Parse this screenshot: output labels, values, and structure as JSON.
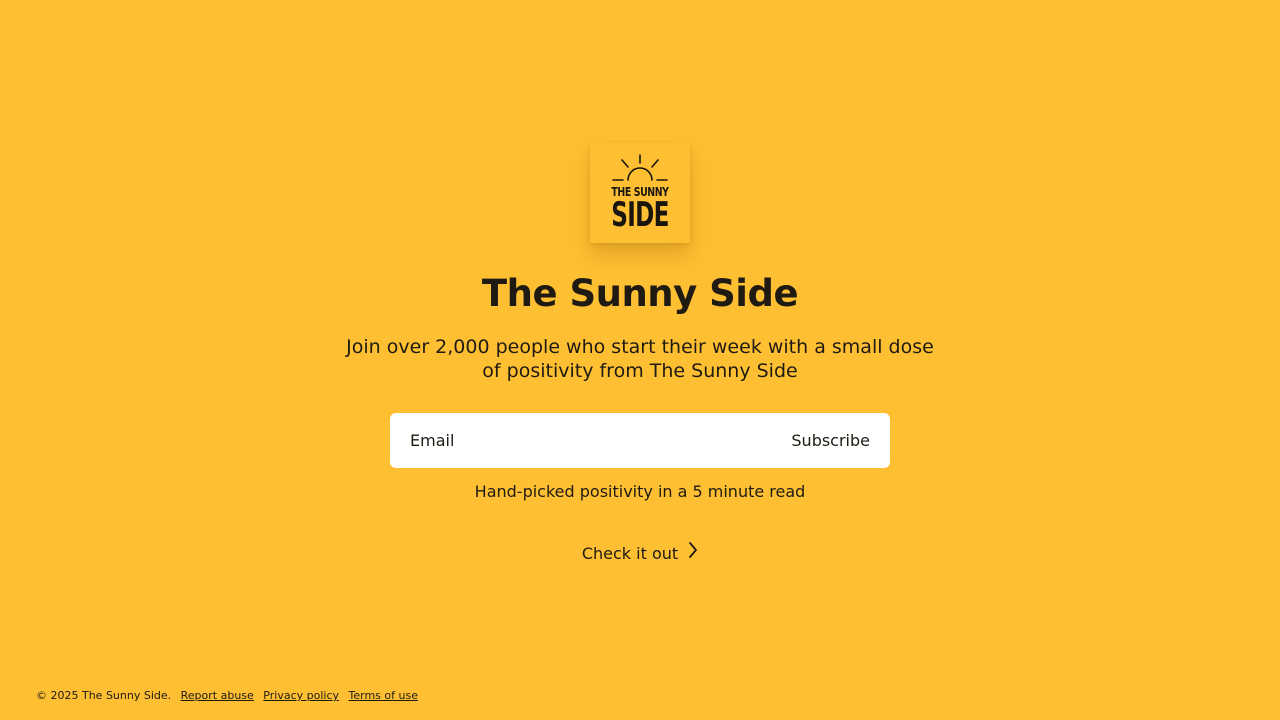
{
  "brand": {
    "logo_line1": "THE SUNNY",
    "logo_line2": "SIDE",
    "logo_icon": "sun-rising-icon"
  },
  "hero": {
    "title": "The Sunny Side",
    "subtitle": "Join over 2,000 people who start their week with a small dose of positivity from The Sunny Side"
  },
  "form": {
    "email_placeholder": "Email",
    "email_value": "",
    "subscribe_label": "Subscribe"
  },
  "tagline": "Hand-picked positivity in a 5 minute read",
  "cta": {
    "label": "Check it out",
    "icon": "chevron-right-icon"
  },
  "footer": {
    "copyright": "© 2025 The Sunny Side.",
    "links": [
      "Report abuse",
      "Privacy policy",
      "Terms of use"
    ]
  },
  "colors": {
    "background": "#FFBF33",
    "text": "#1F1B12",
    "input_bg": "#FFFFFF"
  }
}
